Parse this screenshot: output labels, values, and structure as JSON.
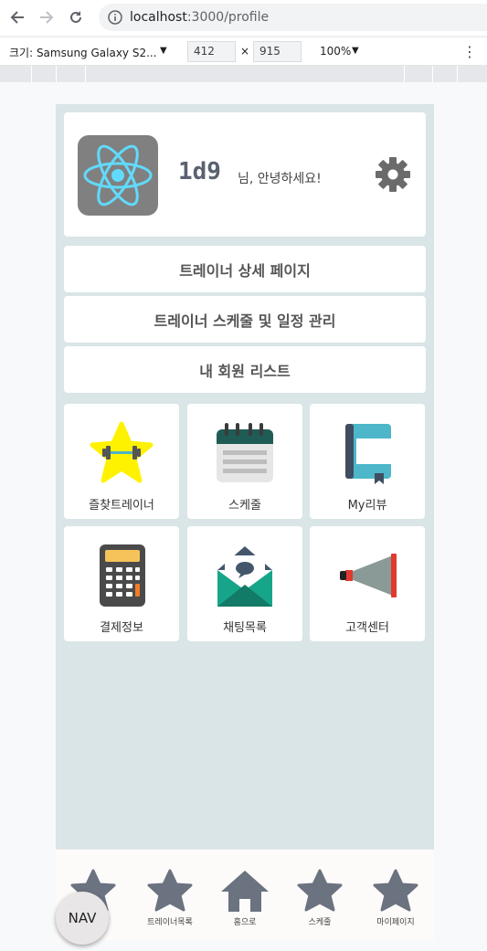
{
  "browser": {
    "url_host": "localhost",
    "url_path": ":3000/profile",
    "device_label": "크기: Samsung Galaxy S2...",
    "width": "412",
    "times": "×",
    "height": "915",
    "zoom": "100%",
    "kebab": "⋮"
  },
  "profile": {
    "username": "1d9",
    "greeting": "님, 안녕하세요!"
  },
  "menu": [
    {
      "label": "트레이너 상세 페이지"
    },
    {
      "label": "트레이너 스케줄 및 일정 관리"
    },
    {
      "label": "내 회원 리스트"
    }
  ],
  "tiles": [
    {
      "label": "즐찾트레이너",
      "icon": "star-dumbbell-icon"
    },
    {
      "label": "스케줄",
      "icon": "calendar-icon"
    },
    {
      "label": "My리뷰",
      "icon": "notebook-icon"
    },
    {
      "label": "결제정보",
      "icon": "calculator-icon"
    },
    {
      "label": "채팅목록",
      "icon": "mail-chat-icon"
    },
    {
      "label": "고객센터",
      "icon": "megaphone-icon"
    }
  ],
  "bottom_nav": [
    {
      "label": "",
      "icon": "star-icon"
    },
    {
      "label": "트레이너목록",
      "icon": "star-icon"
    },
    {
      "label": "홈으로",
      "icon": "home-icon"
    },
    {
      "label": "스케줄",
      "icon": "star-icon"
    },
    {
      "label": "마이페이지",
      "icon": "star-icon"
    }
  ],
  "nav_fab": "NAV",
  "colors": {
    "page_bg": "#d9e5e7",
    "card_bg": "#ffffff",
    "nav_icon": "#6b7280",
    "react_blue": "#61dafb"
  }
}
